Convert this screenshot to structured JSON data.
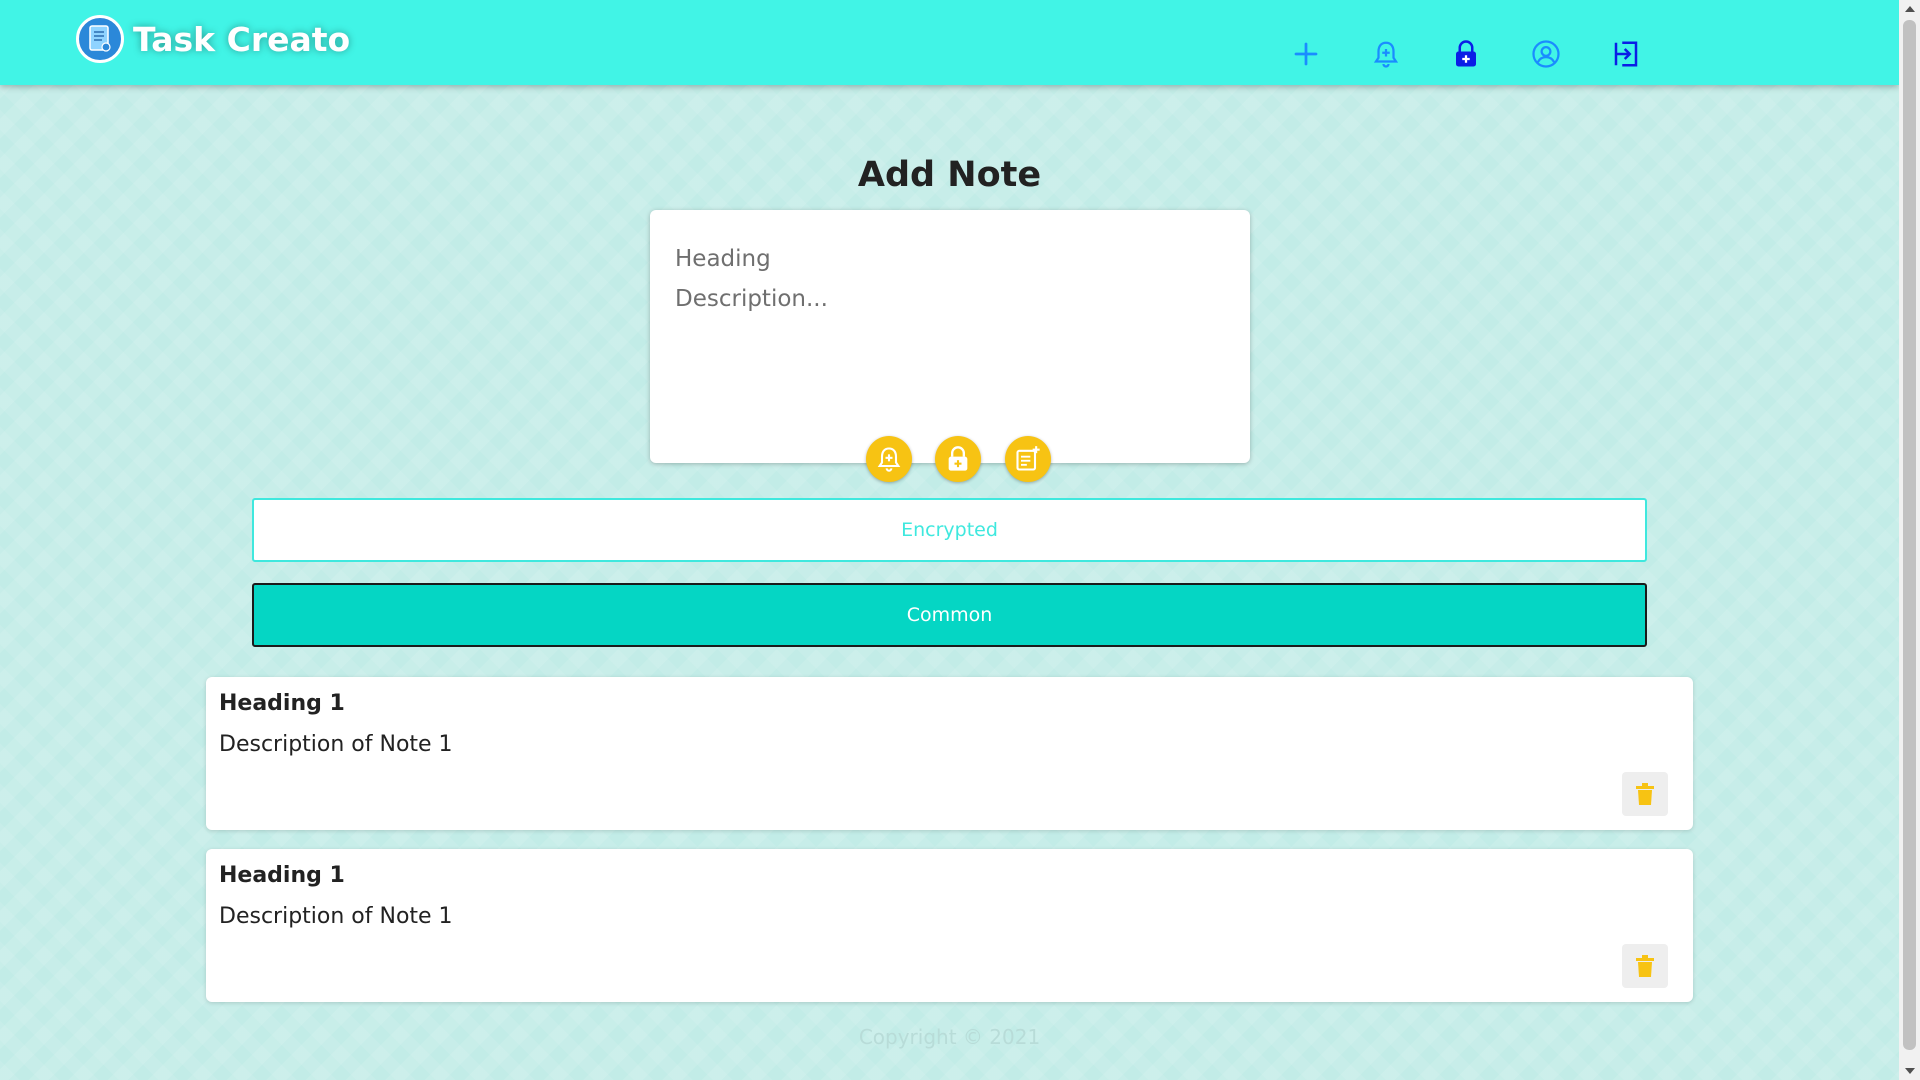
{
  "app": {
    "name": "Task Creato",
    "logo_icon": "notepad-logo-icon"
  },
  "navbar": {
    "icons": [
      {
        "name": "add-icon",
        "color": "#1a8cff"
      },
      {
        "name": "reminder-bell-icon",
        "color": "#1a8cff"
      },
      {
        "name": "lock-icon",
        "color": "#0a1ee6"
      },
      {
        "name": "user-account-icon",
        "color": "#1a8cff"
      },
      {
        "name": "logout-icon",
        "color": "#0a1ee6"
      }
    ]
  },
  "main": {
    "title": "Add Note",
    "form": {
      "heading_placeholder": "Heading",
      "heading_value": "",
      "description_placeholder": "Description...",
      "description_value": ""
    },
    "actions": [
      {
        "name": "add-reminder-icon",
        "color": "#f7c313"
      },
      {
        "name": "add-lock-icon",
        "color": "#f7c313"
      },
      {
        "name": "add-note-icon",
        "color": "#f7c313"
      }
    ],
    "filters": {
      "encrypted_label": "Encrypted",
      "common_label": "Common",
      "active": "Common"
    },
    "notes": [
      {
        "heading": "Heading 1",
        "description": "Description of Note 1"
      },
      {
        "heading": "Heading 1",
        "description": "Description of Note 1"
      }
    ]
  },
  "footer": {
    "copyright": "Copyright © 2021"
  },
  "colors": {
    "navbar_bg": "#41f4e6",
    "page_bg": "#c2ece7",
    "accent_yellow": "#f7c313",
    "common_button_bg": "#05d6c4",
    "encrypted_button_text": "#3fe8de"
  }
}
